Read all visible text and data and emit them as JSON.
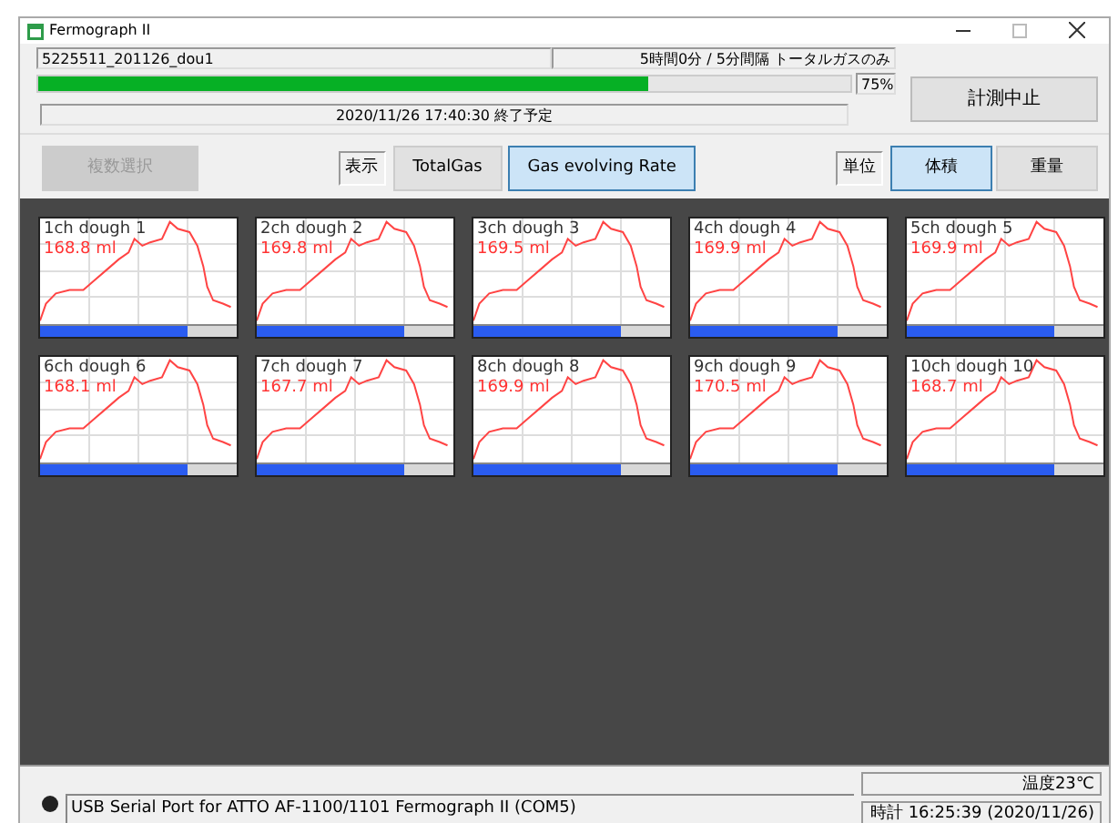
{
  "window": {
    "title": "Fermograph II"
  },
  "header": {
    "run_name": "5225511_201126_dou1",
    "run_info": "5時間0分 / 5分間隔 トータルガスのみ",
    "progress": {
      "level": 0.75,
      "reading": "75%"
    },
    "end_time": "2020/11/26 17:40:30 終了予定",
    "stop_button": "計測中止"
  },
  "toolbar": {
    "multi_select": {
      "label": "複数選択",
      "disabled": true
    },
    "display_label": "表示",
    "display_options": [
      {
        "label": "TotalGas",
        "selected": false
      },
      {
        "label": "Gas evolving Rate",
        "selected": true
      }
    ],
    "unit_label": "単位",
    "unit_options": [
      {
        "label": "体積",
        "selected": true
      },
      {
        "label": "重量",
        "selected": false
      }
    ]
  },
  "channels": [
    {
      "name": "1ch dough 1",
      "value": "168.8 ml",
      "level": 0.75
    },
    {
      "name": "2ch dough 2",
      "value": "169.8 ml",
      "level": 0.75
    },
    {
      "name": "3ch dough 3",
      "value": "169.5 ml",
      "level": 0.75
    },
    {
      "name": "4ch dough 4",
      "value": "169.9 ml",
      "level": 0.75
    },
    {
      "name": "5ch dough 5",
      "value": "169.9 ml",
      "level": 0.75
    },
    {
      "name": "6ch dough 6",
      "value": "168.1 ml",
      "level": 0.75
    },
    {
      "name": "7ch dough 7",
      "value": "167.7 ml",
      "level": 0.75
    },
    {
      "name": "8ch dough 8",
      "value": "169.9 ml",
      "level": 0.75
    },
    {
      "name": "9ch dough 9",
      "value": "170.5 ml",
      "level": 0.75
    },
    {
      "name": "10ch dough 10",
      "value": "168.7 ml",
      "level": 0.75
    }
  ],
  "status_bar": {
    "port": "USB Serial Port for ATTO AF-1100/1101 Fermograph II (COM5)",
    "temperature": "温度23℃",
    "clock": "時計 16:25:39 (2020/11/26)"
  }
}
